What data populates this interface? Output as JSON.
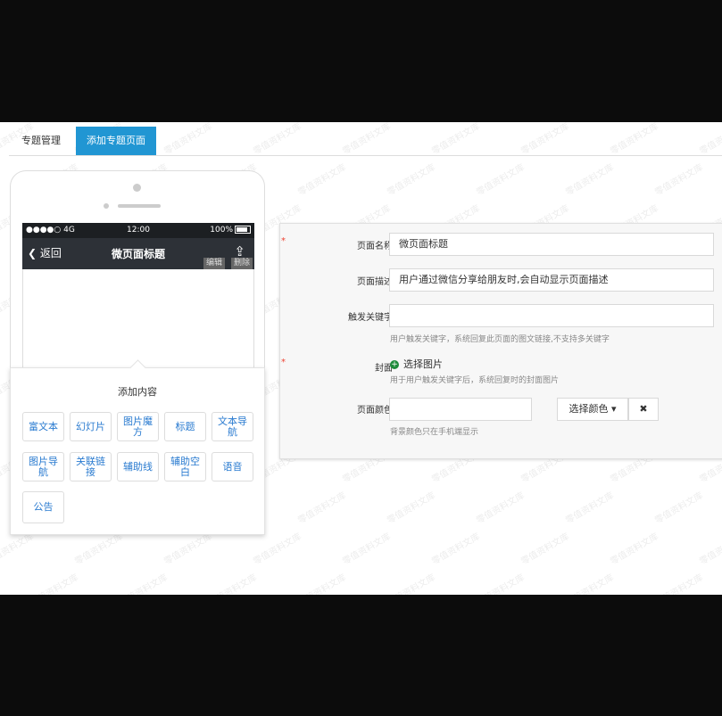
{
  "tabs": [
    {
      "label": "专题管理",
      "active": false
    },
    {
      "label": "添加专题页面",
      "active": true
    }
  ],
  "phone": {
    "status": {
      "signal": "●●●●○ 4G",
      "time": "12:00",
      "battery": "100%"
    },
    "nav": {
      "back": "返回",
      "title": "微页面标题",
      "edit": "编辑",
      "delete": "删除"
    }
  },
  "add_panel": {
    "title": "添加内容",
    "buttons": [
      "富文本",
      "幻灯片",
      "图片魔方",
      "标题",
      "文本导航",
      "图片导航",
      "关联链接",
      "辅助线",
      "辅助空白",
      "语音",
      "公告"
    ]
  },
  "form": {
    "page_name": {
      "label": "页面名称",
      "value": "微页面标题",
      "required": true
    },
    "page_desc": {
      "label": "页面描述",
      "value": "用户通过微信分享给朋友时,会自动显示页面描述"
    },
    "keywords": {
      "label": "触发关键字",
      "value": "",
      "hint": "用户触发关键字，系统回复此页面的图文链接,不支持多关键字"
    },
    "cover": {
      "label": "封面",
      "pick": "选择图片",
      "hint": "用于用户触发关键字后，系统回复时的封面图片",
      "required": true
    },
    "color": {
      "label": "页面颜色",
      "value": "",
      "button": "选择颜色 ▾",
      "clear": "✖",
      "hint": "背景颜色只在手机端显示"
    }
  },
  "watermark": "零值资料文库",
  "colors": {
    "accent": "#2196d3",
    "navbar": "#2d3137",
    "statusbar": "#1c1f22",
    "link": "#2a7bd0"
  }
}
